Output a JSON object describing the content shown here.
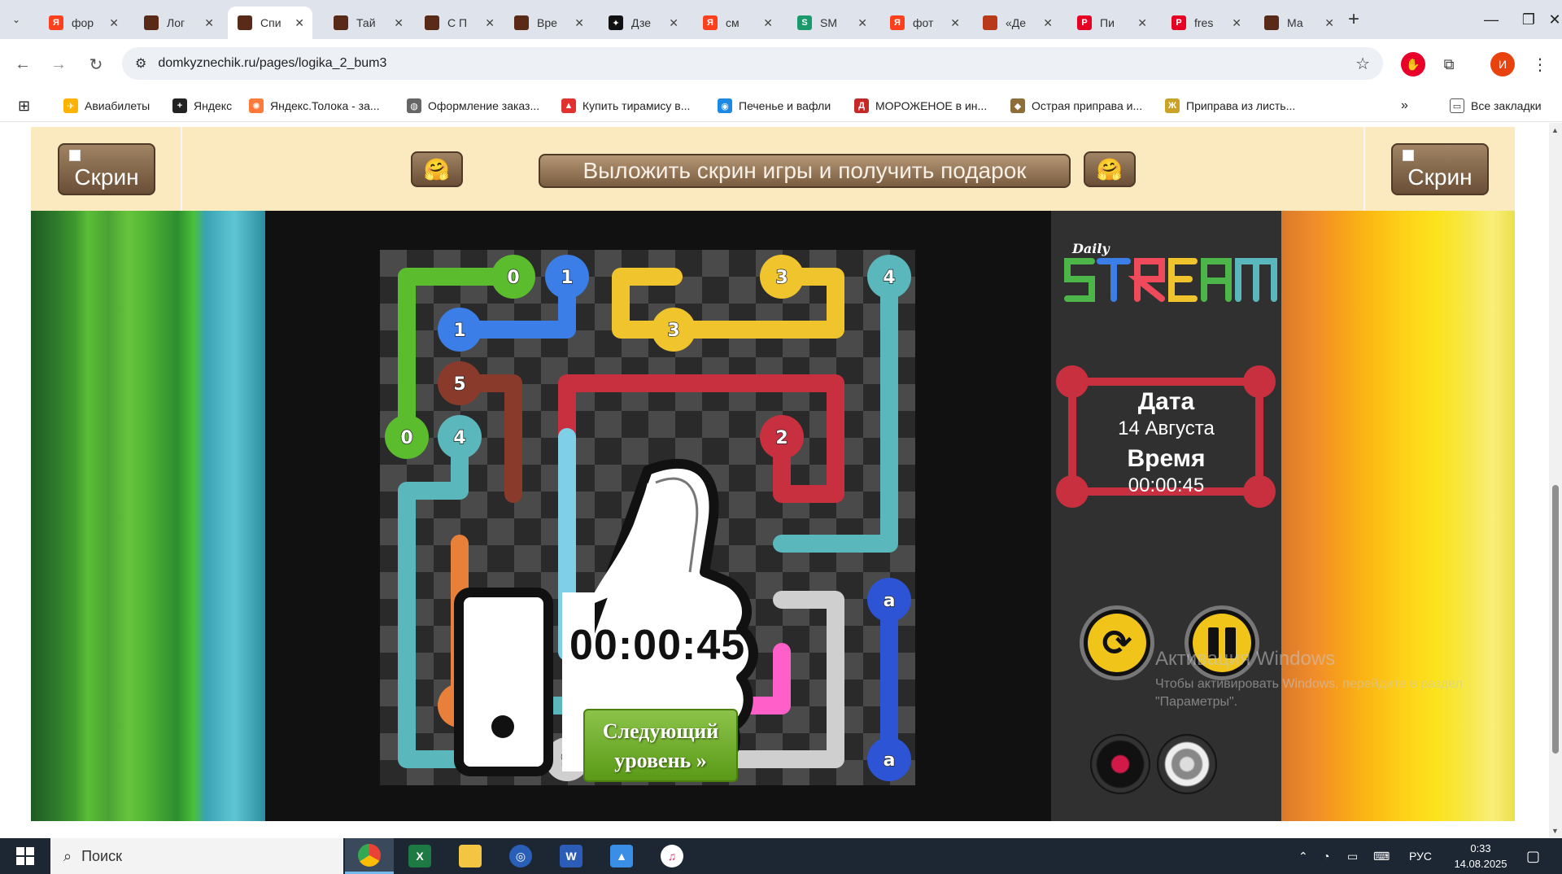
{
  "browser": {
    "tabs": [
      {
        "title": "фор",
        "favicon": "yandex-icon",
        "color": "#fc3f1d",
        "glyph": "Я"
      },
      {
        "title": "Лог",
        "favicon": "site-icon",
        "color": "#5a2a18",
        "glyph": ""
      },
      {
        "title": "Спи",
        "favicon": "site-icon",
        "color": "#5a2a18",
        "glyph": "",
        "active": true
      },
      {
        "title": "Тай",
        "favicon": "site-icon",
        "color": "#5a2a18",
        "glyph": ""
      },
      {
        "title": "С П",
        "favicon": "site-icon",
        "color": "#5a2a18",
        "glyph": ""
      },
      {
        "title": "Вре",
        "favicon": "site-icon",
        "color": "#5a2a18",
        "glyph": ""
      },
      {
        "title": "Дзе",
        "favicon": "dzen-icon",
        "color": "#111111",
        "glyph": "✦"
      },
      {
        "title": "см",
        "favicon": "yandex-icon",
        "color": "#fc3f1d",
        "glyph": "Я"
      },
      {
        "title": "SM",
        "favicon": "sm-icon",
        "color": "#1a9a6a",
        "glyph": "S"
      },
      {
        "title": "фот",
        "favicon": "yandex-icon",
        "color": "#fc3f1d",
        "glyph": "Я"
      },
      {
        "title": "«Де",
        "favicon": "site-icon",
        "color": "#b83a1a",
        "glyph": ""
      },
      {
        "title": "Пи",
        "favicon": "pinterest-icon",
        "color": "#e60023",
        "glyph": "P"
      },
      {
        "title": "fres",
        "favicon": "pinterest-icon",
        "color": "#e60023",
        "glyph": "P"
      },
      {
        "title": "Ма",
        "favicon": "site-icon",
        "color": "#5a2a18",
        "glyph": ""
      }
    ],
    "url": "domkyznechik.ru/pages/logika_2_bum3",
    "profile_initial": "И",
    "bookmarks": [
      {
        "label": "Авиабилеты",
        "icon": "plane-icon",
        "color": "#ffb300",
        "glyph": "✈"
      },
      {
        "label": "Яндекс",
        "icon": "yandex-icon",
        "color": "#222222",
        "glyph": "+"
      },
      {
        "label": "Яндекс.Толока - за...",
        "icon": "toloka-icon",
        "color": "#ff7a3a",
        "glyph": "✺"
      },
      {
        "label": "Оформление заказ...",
        "icon": "globe-icon",
        "color": "#666666",
        "glyph": "◍"
      },
      {
        "label": "Купить тирамису в...",
        "icon": "cake-icon",
        "color": "#e0322e",
        "glyph": "▲"
      },
      {
        "label": "Печенье и вафли",
        "icon": "cookie-icon",
        "color": "#1e88e5",
        "glyph": "◉"
      },
      {
        "label": "МОРОЖЕНОЕ в ин...",
        "icon": "d-icon",
        "color": "#c62828",
        "glyph": "Д"
      },
      {
        "label": "Острая приправа и...",
        "icon": "spice-icon",
        "color": "#8d6e3a",
        "glyph": "◆"
      },
      {
        "label": "Приправа из листь...",
        "icon": "leaf-icon",
        "color": "#c9a227",
        "glyph": "Ж"
      }
    ],
    "all_bookmarks": "Все закладки"
  },
  "page": {
    "screenshot_button": "Скрин",
    "share_banner": "Выложить скрин игры и получить подарок",
    "info": {
      "date_label": "Дата",
      "date_value": "14 Августа",
      "time_label": "Время",
      "time_value": "00:00:45"
    },
    "win": {
      "time": "00:00:45",
      "next_level_line1": "Следующий",
      "next_level_line2": "уровень »"
    },
    "activation": {
      "title": "Активация Windows",
      "line1": "Чтобы активировать Windows, перейдите в раздел",
      "line2": "\"Параметры\"."
    }
  },
  "taskbar": {
    "search_placeholder": "Поиск",
    "language": "РУС",
    "time": "0:33",
    "date": "14.08.2025"
  }
}
